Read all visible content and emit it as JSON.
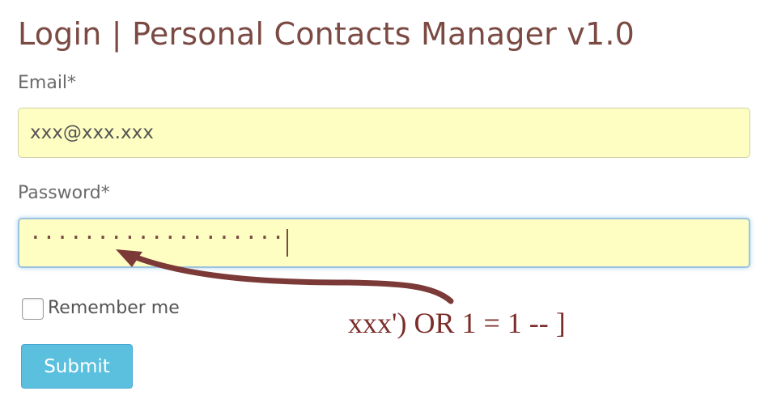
{
  "title": "Login | Personal Contacts Manager v1.0",
  "form": {
    "email_label": "Email*",
    "email_value": "xxx@xxx.xxx",
    "password_label": "Password*",
    "password_masked": "···················",
    "remember_label": "Remember me",
    "remember_checked": false,
    "submit_label": "Submit"
  },
  "annotation": {
    "text": "xxx') OR 1 = 1 -- ]"
  },
  "colors": {
    "title": "#7b4a43",
    "field_background": "#fefec2",
    "submit_button": "#5bc0de",
    "annotation": "#7b2d2a"
  },
  "icons": {
    "checkbox": "checkbox-icon",
    "arrow": "curved-arrow-icon"
  }
}
